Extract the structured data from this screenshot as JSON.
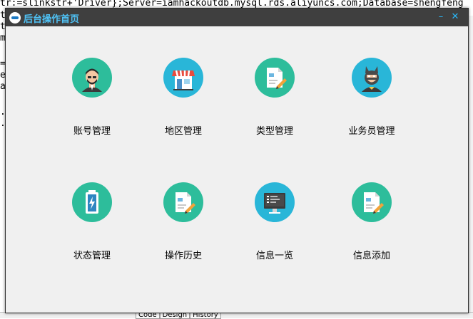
{
  "background_editor": {
    "line1_prefix": "tr:=slinkstr+'Driver};Server=iamhackoutdb.mysql.rds.aliyuncs.com;Database=shengfeng",
    "margin_chars": [
      "t",
      "r",
      "t",
      "m",
      "=",
      "e",
      "a",
      ".",
      "."
    ],
    "bottom_tabs": [
      "Code",
      "Design",
      "History"
    ]
  },
  "window": {
    "title": "后台操作首页",
    "min_glyph": "–",
    "close_glyph": "✕"
  },
  "tiles": [
    {
      "label": "账号管理",
      "icon": "user-avatar-icon",
      "color": "#2dbd9b"
    },
    {
      "label": "地区管理",
      "icon": "store-icon",
      "color": "#29b6d8"
    },
    {
      "label": "类型管理",
      "icon": "document-edit-icon",
      "color": "#2dbd9b"
    },
    {
      "label": "业务员管理",
      "icon": "masked-person-icon",
      "color": "#29b6d8"
    },
    {
      "label": "状态管理",
      "icon": "battery-charging-icon",
      "color": "#2dbd9b"
    },
    {
      "label": "操作历史",
      "icon": "document-edit-icon",
      "color": "#2dbd9b"
    },
    {
      "label": "信息一览",
      "icon": "monitor-icon",
      "color": "#29b6d8"
    },
    {
      "label": "信息添加",
      "icon": "document-edit-icon",
      "color": "#2dbd9b"
    }
  ]
}
